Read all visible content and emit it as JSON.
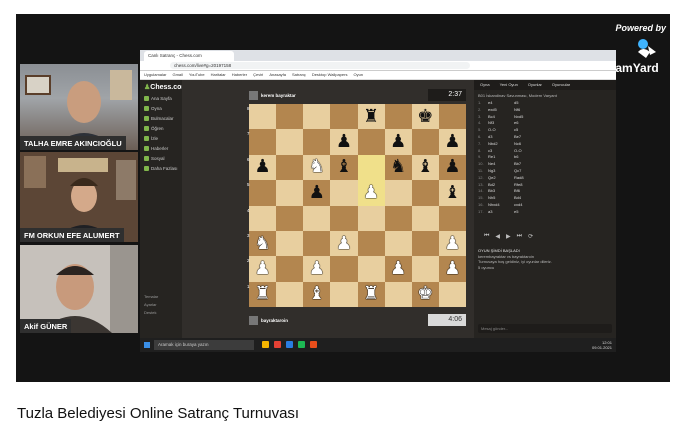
{
  "video": {
    "title": "Tuzla Belediyesi Online Satranç Turnuvası",
    "powered_by": "Powered by",
    "brand": "StreamYard"
  },
  "participants": [
    {
      "name": "TALHA EMRE AKINCIOĞLU"
    },
    {
      "name": "FM ORKUN EFE ALUMERT"
    },
    {
      "name": "Akif GÜNER"
    }
  ],
  "browser": {
    "tab": "Canlı Satranç - Chess.com",
    "url": "chess.com/live#g=20197158",
    "bookmarks": [
      "Uygulamalar",
      "Gmail",
      "YouTube",
      "Haritalar",
      "Haberler",
      "Çeviri",
      "Anasayfa",
      "Satranç",
      "Desktop Wallpapers",
      "Oyun"
    ]
  },
  "sidebar": {
    "logo": "Chess.com",
    "items": [
      "Ana Sayfa",
      "Oyna",
      "Bulmacalar",
      "Öğren",
      "İzle",
      "Haberler",
      "Sosyal",
      "Daha Fazlası"
    ],
    "bottom": [
      "Temalar",
      "Ayarlar",
      "Destek"
    ]
  },
  "game": {
    "top_player": "kerem bayraktar",
    "bottom_player": "bayraktaroin",
    "top_clock": "2:37",
    "bottom_clock": "4:06",
    "ranks": [
      "8",
      "7",
      "6",
      "5",
      "4",
      "3",
      "2",
      "1"
    ]
  },
  "panel": {
    "tabs": [
      "Oyna",
      "Yeni Oyun",
      "Oyunlar",
      "Oyuncular"
    ],
    "opening": "B01 İskandinav Savunması, Modern Varyant",
    "moves": [
      [
        "1.",
        "e4",
        "d5"
      ],
      [
        "2.",
        "exd5",
        "Nf6"
      ],
      [
        "3.",
        "Bc4",
        "Nxd5"
      ],
      [
        "4.",
        "Nf3",
        "e6"
      ],
      [
        "5.",
        "O-O",
        "c5"
      ],
      [
        "6.",
        "d3",
        "Be7"
      ],
      [
        "7.",
        "Nbd2",
        "Nc6"
      ],
      [
        "8.",
        "c3",
        "O-O"
      ],
      [
        "9.",
        "Re1",
        "b6"
      ],
      [
        "10.",
        "Ne4",
        "Bb7"
      ],
      [
        "11.",
        "Ng3",
        "Qc7"
      ],
      [
        "12.",
        "Qe2",
        "Rad8"
      ],
      [
        "13.",
        "Bd2",
        "Rfe8"
      ],
      [
        "14.",
        "Bb3",
        "Bf6"
      ],
      [
        "15.",
        "Nh5",
        "Bd4"
      ],
      [
        "16.",
        "Nhxd4",
        "cxd4"
      ],
      [
        "17.",
        "a3",
        "e5"
      ]
    ],
    "controls": [
      "⏮",
      "◀",
      "▶",
      "⏭",
      "⟳"
    ],
    "chat": [
      "OYUN ŞİMDİ BAŞLADI",
      "kerembayraktar vs bayraktaroin",
      "Turnuvaya hoş geldiniz, iyi oyunlar dileriz.",
      "5 oyuncu"
    ],
    "chat_placeholder": "Mesaj gönder..."
  },
  "taskbar": {
    "search": "Aramak için buraya yazın",
    "time": "12:01",
    "date": "09.01.2021"
  }
}
